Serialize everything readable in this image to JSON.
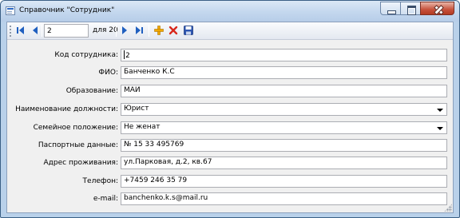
{
  "window": {
    "title": "Справочник \"Сотрудник\""
  },
  "navigator": {
    "position": "2",
    "count_label": "для 20"
  },
  "form": {
    "fields": [
      {
        "label": "Код сотрудника:",
        "value": "2"
      },
      {
        "label": "ФИО:",
        "value": "Банченко К.С"
      },
      {
        "label": "Образование:",
        "value": "МАИ"
      },
      {
        "label": "Наименование должности:",
        "value": "Юрист"
      },
      {
        "label": "Семейное положение:",
        "value": "Не женат"
      },
      {
        "label": "Паспортные данные:",
        "value": "№ 15 33 495769"
      },
      {
        "label": "Адрес проживания:",
        "value": "ул.Парковая, д.2, кв.67"
      },
      {
        "label": "Телефон:",
        "value": "+7459 246 35 79"
      },
      {
        "label": "e-mail:",
        "value": "banchenko.k.s@mail.ru"
      }
    ]
  },
  "colors": {
    "title_bar": "#c3d7ee",
    "client_bg": "#f0f0f0",
    "nav_icon": "#1f5fbf",
    "add_icon": "#f0a800",
    "delete_icon": "#d8281c",
    "save_icon": "#2d55b0"
  },
  "icons": {
    "window": "form-icon",
    "first": "move-first-icon",
    "prev": "move-previous-icon",
    "next": "move-next-icon",
    "last": "move-last-icon",
    "add": "add-new-icon",
    "delete": "delete-icon",
    "save": "save-icon"
  }
}
